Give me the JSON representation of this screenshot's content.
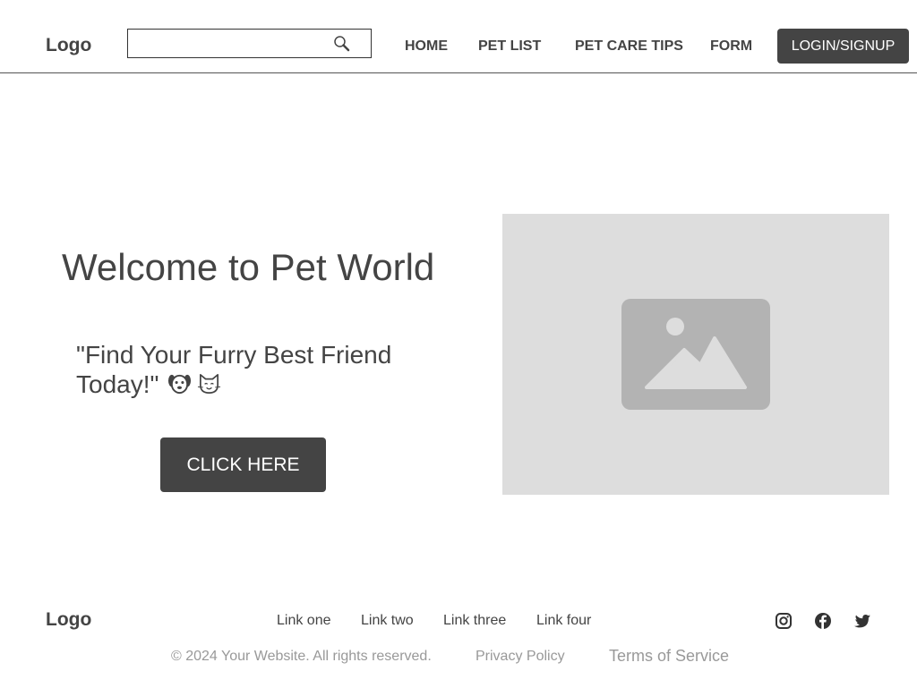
{
  "header": {
    "logo": "Logo",
    "search": {
      "value": "",
      "placeholder": "",
      "icon": "search-icon"
    },
    "nav": [
      {
        "label": "HOME"
      },
      {
        "label": "PET LIST"
      },
      {
        "label": "PET CARE TIPS"
      },
      {
        "label": "FORM"
      }
    ],
    "login_label": "LOGIN/SIGNUP"
  },
  "hero": {
    "title": "Welcome to Pet World",
    "quote": "\"Find Your Furry Best Friend Today!\"",
    "pet_icons": [
      "dog-face-icon",
      "cat-face-icon"
    ],
    "cta_label": "CLICK HERE",
    "image_icon": "image-placeholder-icon"
  },
  "footer": {
    "logo": "Logo",
    "links": [
      {
        "label": "Link one"
      },
      {
        "label": "Link two"
      },
      {
        "label": "Link three"
      },
      {
        "label": "Link four"
      }
    ],
    "social_icons": [
      "instagram-icon",
      "facebook-icon",
      "twitter-icon"
    ],
    "copyright": "© 2024 Your Website. All rights reserved.",
    "privacy": "Privacy Policy",
    "terms": "Terms of Service"
  },
  "colors": {
    "primary": "#444444",
    "placeholder_bg": "#dddddd",
    "placeholder_icon": "#b3b3b3",
    "muted_text": "#999999"
  }
}
